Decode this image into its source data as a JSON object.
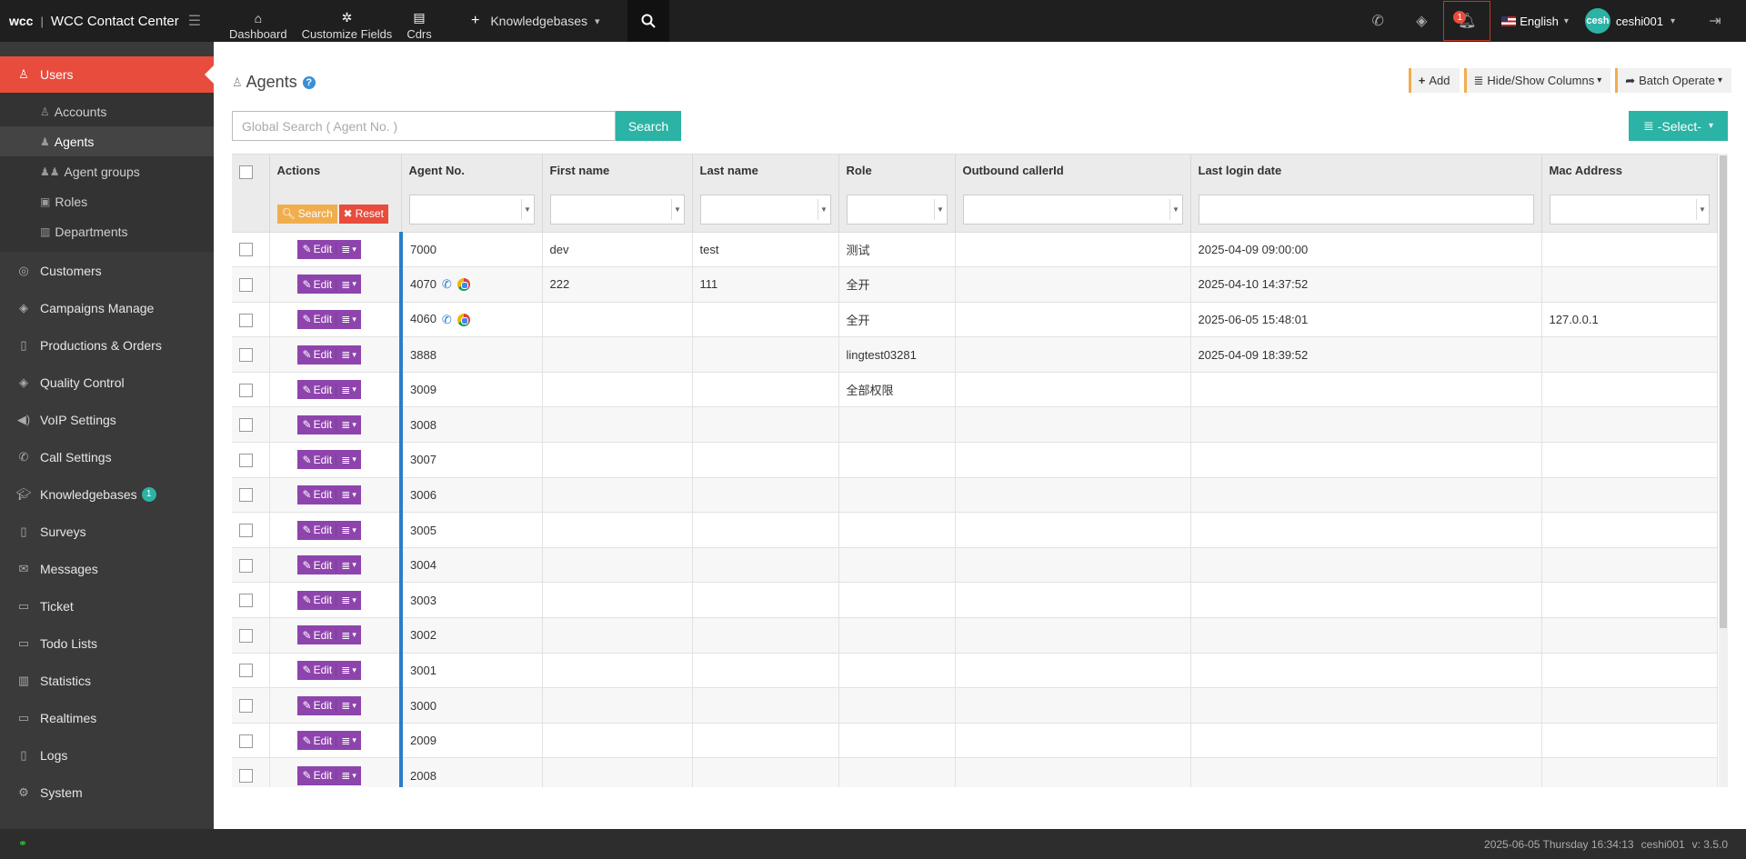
{
  "brand": {
    "logo": "wcc",
    "name": "WCC Contact Center"
  },
  "topnav": [
    {
      "label": "Dashboard",
      "icon": "home-icon"
    },
    {
      "label": "Customize Fields",
      "icon": "gear-icon"
    },
    {
      "label": "Cdrs",
      "icon": "clipboard-icon"
    }
  ],
  "kb_nav": {
    "label": "Knowledgebases"
  },
  "notifications": {
    "count": "1"
  },
  "language": {
    "label": "English"
  },
  "user": {
    "avatar": "cesh",
    "name": "ceshi001"
  },
  "sidebar": {
    "items": [
      {
        "label": "Users",
        "icon": "user-icon"
      },
      {
        "label": "Customers",
        "icon": "coins-icon"
      },
      {
        "label": "Campaigns Manage",
        "icon": "layers-icon"
      },
      {
        "label": "Productions & Orders",
        "icon": "document-icon"
      },
      {
        "label": "Quality Control",
        "icon": "layers-icon"
      },
      {
        "label": "VoIP Settings",
        "icon": "volume-icon"
      },
      {
        "label": "Call Settings",
        "icon": "phone-icon"
      },
      {
        "label": "Knowledgebases",
        "icon": "graduation-cap-icon",
        "badge": "1"
      },
      {
        "label": "Surveys",
        "icon": "document-icon"
      },
      {
        "label": "Messages",
        "icon": "envelope-icon"
      },
      {
        "label": "Ticket",
        "icon": "folder-icon"
      },
      {
        "label": "Todo Lists",
        "icon": "folder-icon"
      },
      {
        "label": "Statistics",
        "icon": "bar-chart-icon"
      },
      {
        "label": "Realtimes",
        "icon": "monitor-icon"
      },
      {
        "label": "Logs",
        "icon": "book-icon"
      },
      {
        "label": "System",
        "icon": "gear-icon"
      }
    ],
    "sub_items": [
      {
        "label": "Accounts"
      },
      {
        "label": "Agents"
      },
      {
        "label": "Agent groups"
      },
      {
        "label": "Roles"
      },
      {
        "label": "Departments"
      }
    ]
  },
  "page": {
    "title": "Agents",
    "help": "?"
  },
  "toolbar": {
    "add": "Add",
    "hide_show": "Hide/Show Columns",
    "batch": "Batch Operate"
  },
  "search": {
    "placeholder": "Global Search ( Agent No. )",
    "button": "Search"
  },
  "select_button": "-Select-",
  "table": {
    "headers": {
      "actions": "Actions",
      "agent_no": "Agent No.",
      "first_name": "First name",
      "last_name": "Last name",
      "role": "Role",
      "outbound": "Outbound callerId",
      "last_login": "Last login date",
      "mac": "Mac Address"
    },
    "action_search": "Search",
    "action_reset": "Reset",
    "edit_label": "Edit",
    "rows": [
      {
        "agent_no": "7000",
        "first_name": "dev",
        "last_name": "test",
        "role": "测试",
        "outbound": "",
        "last_login": "2025-04-09 09:00:00",
        "mac": "",
        "icons": false
      },
      {
        "agent_no": "4070",
        "first_name": "222",
        "last_name": "111",
        "role": "全开",
        "outbound": "",
        "last_login": "2025-04-10 14:37:52",
        "mac": "",
        "icons": true
      },
      {
        "agent_no": "4060",
        "first_name": "",
        "last_name": "",
        "role": "全开",
        "outbound": "",
        "last_login": "2025-06-05 15:48:01",
        "mac": "127.0.0.1",
        "icons": true
      },
      {
        "agent_no": "3888",
        "first_name": "",
        "last_name": "",
        "role": "lingtest03281",
        "outbound": "",
        "last_login": "2025-04-09 18:39:52",
        "mac": "",
        "icons": false
      },
      {
        "agent_no": "3009",
        "first_name": "",
        "last_name": "",
        "role": "全部权限",
        "outbound": "",
        "last_login": "",
        "mac": "",
        "icons": false
      },
      {
        "agent_no": "3008",
        "first_name": "",
        "last_name": "",
        "role": "",
        "outbound": "",
        "last_login": "",
        "mac": "",
        "icons": false
      },
      {
        "agent_no": "3007",
        "first_name": "",
        "last_name": "",
        "role": "",
        "outbound": "",
        "last_login": "",
        "mac": "",
        "icons": false
      },
      {
        "agent_no": "3006",
        "first_name": "",
        "last_name": "",
        "role": "",
        "outbound": "",
        "last_login": "",
        "mac": "",
        "icons": false
      },
      {
        "agent_no": "3005",
        "first_name": "",
        "last_name": "",
        "role": "",
        "outbound": "",
        "last_login": "",
        "mac": "",
        "icons": false
      },
      {
        "agent_no": "3004",
        "first_name": "",
        "last_name": "",
        "role": "",
        "outbound": "",
        "last_login": "",
        "mac": "",
        "icons": false
      },
      {
        "agent_no": "3003",
        "first_name": "",
        "last_name": "",
        "role": "",
        "outbound": "",
        "last_login": "",
        "mac": "",
        "icons": false
      },
      {
        "agent_no": "3002",
        "first_name": "",
        "last_name": "",
        "role": "",
        "outbound": "",
        "last_login": "",
        "mac": "",
        "icons": false
      },
      {
        "agent_no": "3001",
        "first_name": "",
        "last_name": "",
        "role": "",
        "outbound": "",
        "last_login": "",
        "mac": "",
        "icons": false
      },
      {
        "agent_no": "3000",
        "first_name": "",
        "last_name": "",
        "role": "",
        "outbound": "",
        "last_login": "",
        "mac": "",
        "icons": false
      },
      {
        "agent_no": "2009",
        "first_name": "",
        "last_name": "",
        "role": "",
        "outbound": "",
        "last_login": "",
        "mac": "",
        "icons": false
      },
      {
        "agent_no": "2008",
        "first_name": "",
        "last_name": "",
        "role": "",
        "outbound": "",
        "last_login": "",
        "mac": "",
        "icons": false
      }
    ]
  },
  "footer": {
    "datetime": "2025-06-05 Thursday 16:34:13",
    "user": "ceshi001",
    "version": "v: 3.5.0"
  },
  "colors": {
    "accent_red": "#e74c3c",
    "teal": "#2bb3a5",
    "purple": "#8e44ad",
    "sidebar": "#3a3a3a"
  }
}
